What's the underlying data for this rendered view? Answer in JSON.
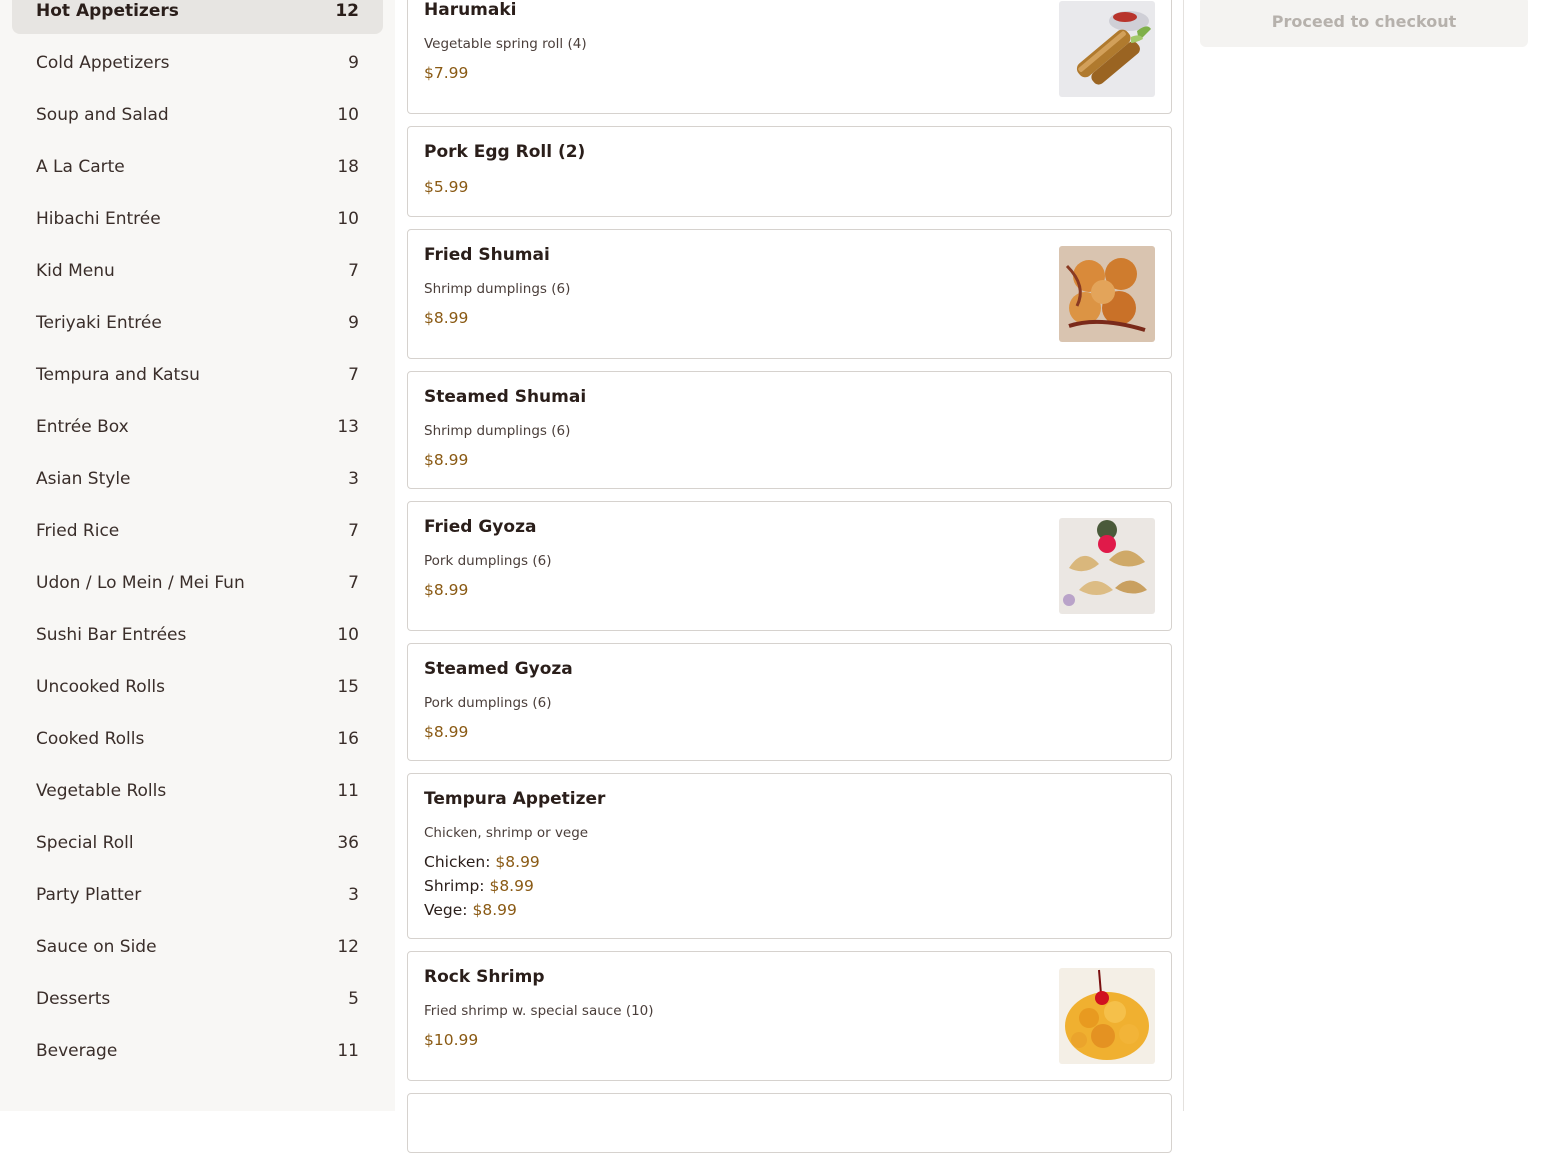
{
  "categories": [
    {
      "label": "Hot Appetizers",
      "count": "12",
      "active": true
    },
    {
      "label": "Cold Appetizers",
      "count": "9"
    },
    {
      "label": "Soup and Salad",
      "count": "10"
    },
    {
      "label": "A La Carte",
      "count": "18"
    },
    {
      "label": "Hibachi Entrée",
      "count": "10"
    },
    {
      "label": "Kid Menu",
      "count": "7"
    },
    {
      "label": "Teriyaki Entrée",
      "count": "9"
    },
    {
      "label": "Tempura and Katsu",
      "count": "7"
    },
    {
      "label": "Entrée Box",
      "count": "13"
    },
    {
      "label": "Asian Style",
      "count": "3"
    },
    {
      "label": "Fried Rice",
      "count": "7"
    },
    {
      "label": "Udon / Lo Mein / Mei Fun",
      "count": "7"
    },
    {
      "label": "Sushi Bar Entrées",
      "count": "10"
    },
    {
      "label": "Uncooked Rolls",
      "count": "15"
    },
    {
      "label": "Cooked Rolls",
      "count": "16"
    },
    {
      "label": "Vegetable Rolls",
      "count": "11"
    },
    {
      "label": "Special Roll",
      "count": "36"
    },
    {
      "label": "Party Platter",
      "count": "3"
    },
    {
      "label": "Sauce on Side",
      "count": "12"
    },
    {
      "label": "Desserts",
      "count": "5"
    },
    {
      "label": "Beverage",
      "count": "11"
    }
  ],
  "items": [
    {
      "name": "Harumaki",
      "desc": "Vegetable spring roll (4)",
      "price": "$7.99",
      "image": "spring-roll-photo"
    },
    {
      "name": "Pork Egg Roll (2)",
      "price": "$5.99"
    },
    {
      "name": "Fried Shumai",
      "desc": "Shrimp dumplings (6)",
      "price": "$8.99",
      "image": "fried-shumai-photo"
    },
    {
      "name": "Steamed Shumai",
      "desc": "Shrimp dumplings (6)",
      "price": "$8.99"
    },
    {
      "name": "Fried Gyoza",
      "desc": "Pork dumplings (6)",
      "price": "$8.99",
      "image": "gyoza-photo"
    },
    {
      "name": "Steamed Gyoza",
      "desc": "Pork dumplings (6)",
      "price": "$8.99"
    },
    {
      "name": "Tempura Appetizer",
      "desc": "Chicken, shrimp or vege",
      "options": [
        {
          "label": "Chicken:",
          "price": "$8.99"
        },
        {
          "label": "Shrimp:",
          "price": "$8.99"
        },
        {
          "label": "Vege:",
          "price": "$8.99"
        }
      ]
    },
    {
      "name": "Rock Shrimp",
      "desc": "Fried shrimp w. special sauce (10)",
      "price": "$10.99",
      "image": "rock-shrimp-photo"
    }
  ],
  "checkout": {
    "label": "Proceed to checkout"
  }
}
